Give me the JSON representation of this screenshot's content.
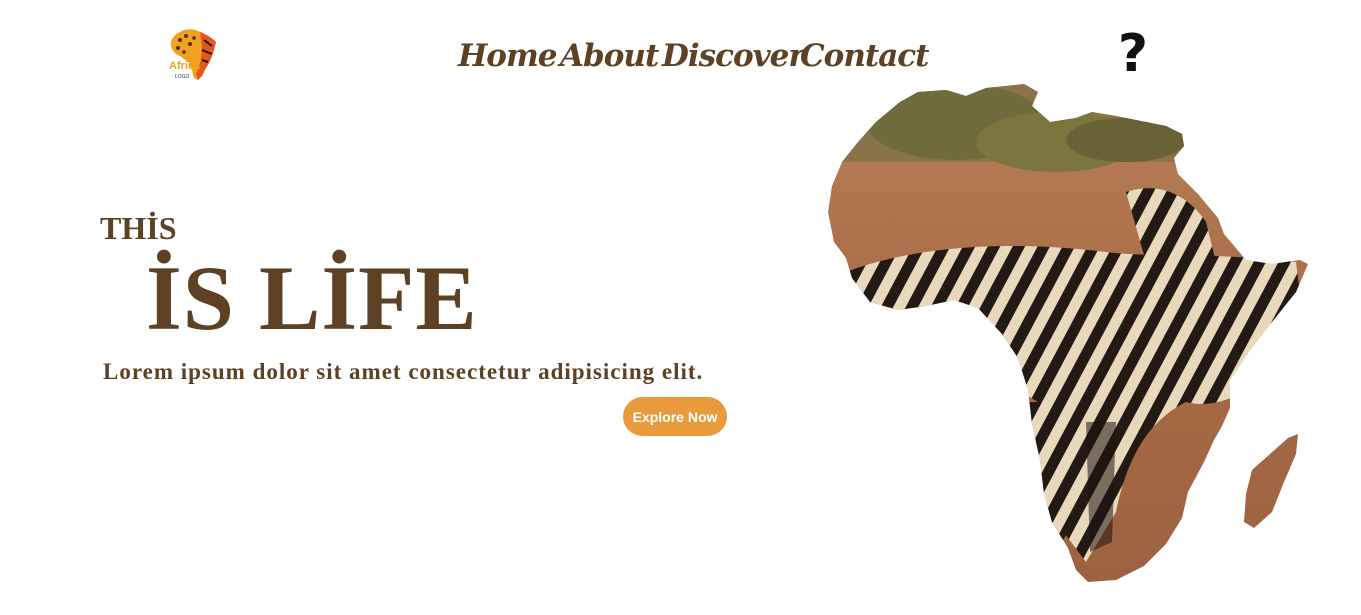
{
  "header": {
    "logo_text": "Africa",
    "logo_subtext": "LOGO",
    "nav": [
      {
        "label": "Home"
      },
      {
        "label": "About"
      },
      {
        "label": "Discover"
      },
      {
        "label": "Contact"
      }
    ],
    "help_glyph": "?"
  },
  "hero": {
    "line1": "THİS",
    "line2": "İS LİFE",
    "lead": "Lorem ipsum dolor sit amet consectetur adipisicing elit.",
    "cta_label": "Explore Now"
  },
  "colors": {
    "text_brown": "#5e4124",
    "button_orange": "#e89a3c",
    "background": "#ffffff"
  },
  "icons": {
    "logo": "africa-logo-icon",
    "help": "question-mark-icon",
    "map": "africa-map-zebra-image"
  }
}
